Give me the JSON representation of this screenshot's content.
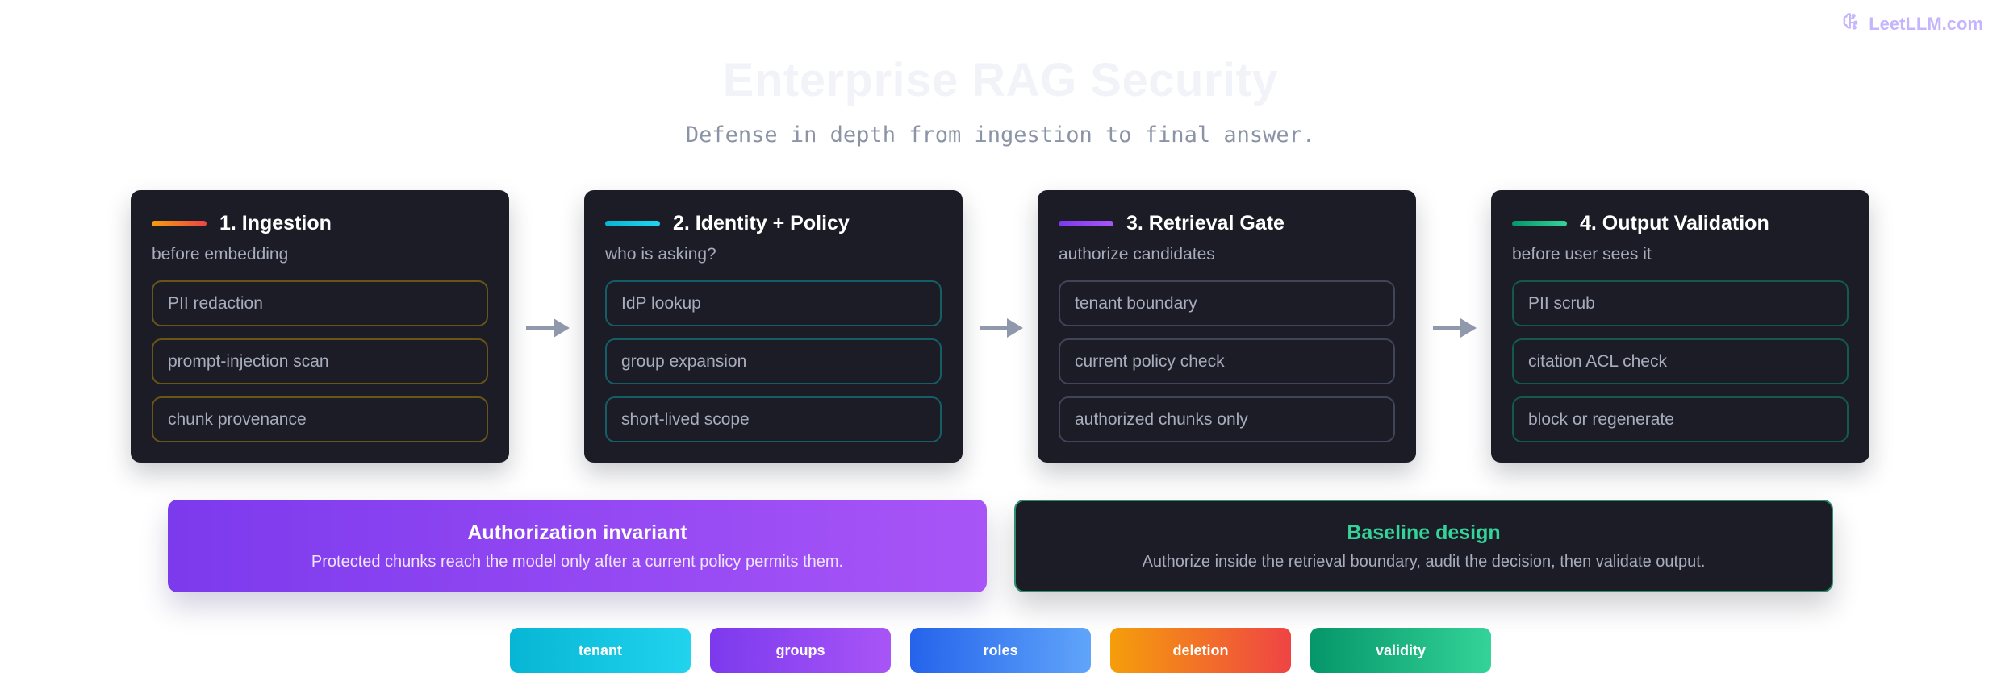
{
  "brand": {
    "name": "LeetLLM.com",
    "icon": "brain-icon",
    "color": "#c4b5fd"
  },
  "header": {
    "title": "Enterprise RAG Security",
    "subtitle": "Defense in depth from ingestion to final answer."
  },
  "stages": [
    {
      "title": "1. Ingestion",
      "subtitle": "before embedding",
      "accent": [
        "#f59e0b",
        "#ef4444"
      ],
      "border": "#6b5418",
      "items": [
        "PII redaction",
        "prompt-injection scan",
        "chunk provenance"
      ]
    },
    {
      "title": "2. Identity + Policy",
      "subtitle": "who is asking?",
      "accent": [
        "#06b6d4",
        "#22d3ee"
      ],
      "border": "#155e68",
      "items": [
        "IdP lookup",
        "group expansion",
        "short-lived scope"
      ]
    },
    {
      "title": "3. Retrieval Gate",
      "subtitle": "authorize candidates",
      "accent": [
        "#7c3aed",
        "#a855f7"
      ],
      "border": "#41455a",
      "items": [
        "tenant boundary",
        "current policy check",
        "authorized chunks only"
      ]
    },
    {
      "title": "4. Output Validation",
      "subtitle": "before user sees it",
      "accent": [
        "#059669",
        "#34d399"
      ],
      "border": "#135a4a",
      "items": [
        "PII scrub",
        "citation ACL check",
        "block or regenerate"
      ]
    }
  ],
  "banners": {
    "invariant": {
      "title": "Authorization invariant",
      "text": "Protected chunks reach the model only after a current policy permits them."
    },
    "baseline": {
      "title": "Baseline design",
      "text": "Authorize inside the retrieval boundary, audit the decision, then validate output."
    }
  },
  "chips": [
    {
      "label": "tenant",
      "colors": [
        "#06b6d4",
        "#22d3ee"
      ]
    },
    {
      "label": "groups",
      "colors": [
        "#7c3aed",
        "#a855f7"
      ]
    },
    {
      "label": "roles",
      "colors": [
        "#2563eb",
        "#60a5fa"
      ]
    },
    {
      "label": "deletion",
      "colors": [
        "#f59e0b",
        "#ef4444"
      ]
    },
    {
      "label": "validity",
      "colors": [
        "#059669",
        "#34d399"
      ]
    }
  ],
  "colors": {
    "card_bg": "#1b1c26",
    "arrow": "#8f99ab",
    "baseline_title": "#34d399",
    "baseline_border": "#2f8f6c"
  }
}
